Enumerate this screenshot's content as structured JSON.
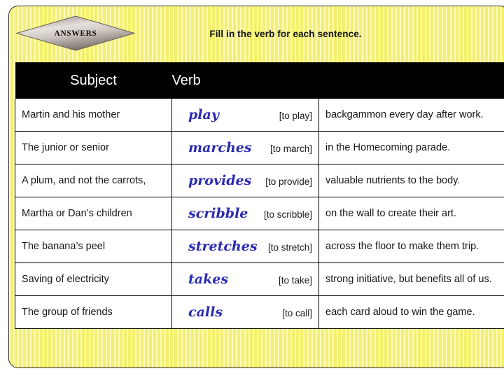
{
  "slide": {
    "badge_label": "ANSWERS",
    "instruction": "Fill in the verb for each sentence.",
    "panel_color": "#f7f479",
    "header_color": "#000000",
    "answer_color": "#2a2ab4"
  },
  "table": {
    "columns": [
      "Subject",
      "Verb",
      ""
    ],
    "rows": [
      {
        "subject": "Martin and his mother",
        "verb": "play",
        "cue": "[to play]",
        "predicate": "backgammon every day after work."
      },
      {
        "subject": "The junior or senior",
        "verb": "marches",
        "cue": "[to march]",
        "predicate": "in the Homecoming parade."
      },
      {
        "subject": "A plum, and not the carrots,",
        "verb": "provides",
        "cue": "[to provide]",
        "predicate": "valuable nutrients to the body."
      },
      {
        "subject": "Martha or Dan’s children",
        "verb": "scribble",
        "cue": "[to scribble]",
        "predicate": "on the wall to create their art."
      },
      {
        "subject": "The banana’s peel",
        "verb": "stretches",
        "cue": "[to stretch]",
        "predicate": "across the floor to make them trip."
      },
      {
        "subject": "Saving of electricity",
        "verb": "takes",
        "cue": "[to take]",
        "predicate": "strong initiative, but benefits all of us."
      },
      {
        "subject": "The group of friends",
        "verb": "calls",
        "cue": "[to call]",
        "predicate": "each card aloud to win the game."
      }
    ]
  }
}
